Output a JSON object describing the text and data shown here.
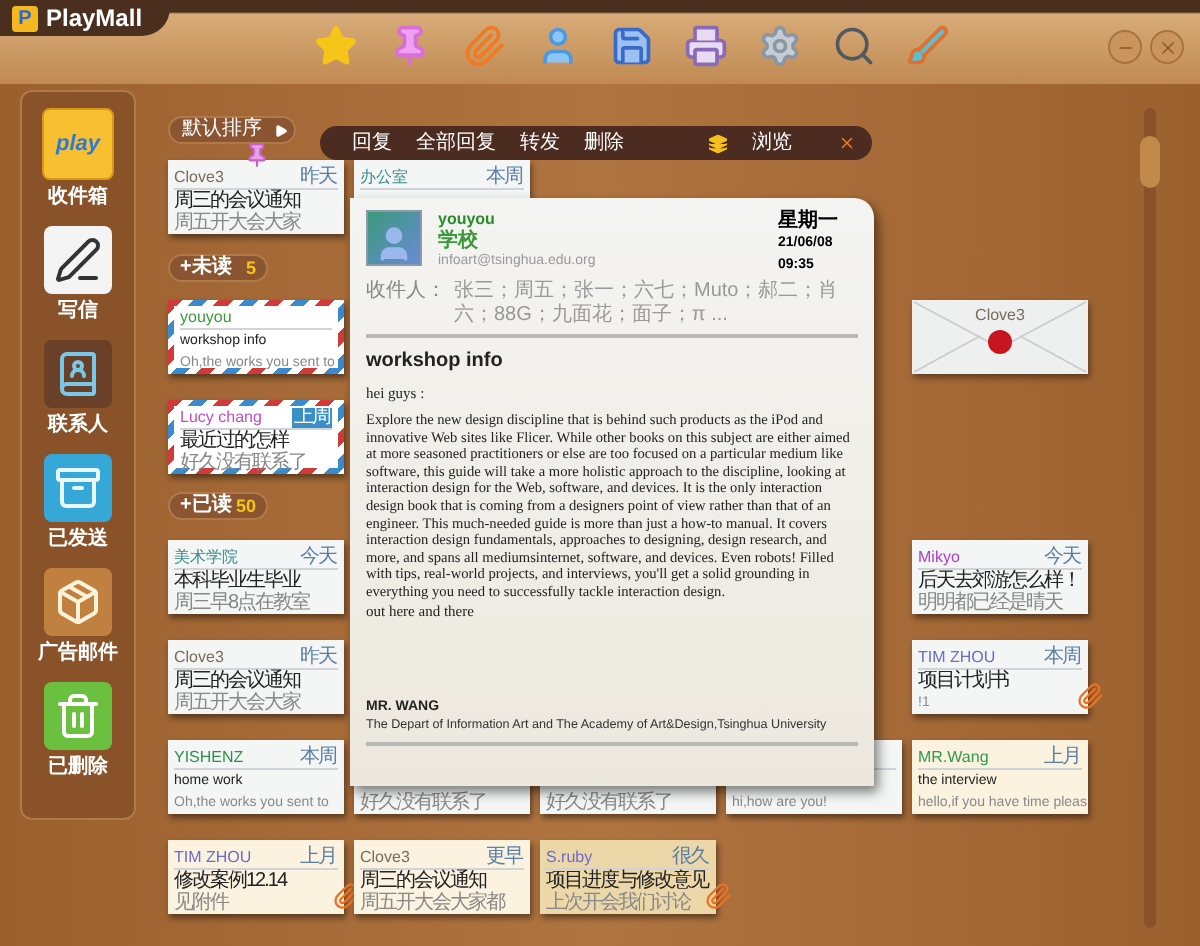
{
  "app": {
    "logo_mark": "P",
    "title": "PlayMall"
  },
  "sidebar": {
    "items": [
      {
        "label": "收件箱",
        "icon_text": "play"
      },
      {
        "label": "写信"
      },
      {
        "label": "联系人"
      },
      {
        "label": "已发送"
      },
      {
        "label": "广告邮件"
      },
      {
        "label": "已删除"
      }
    ]
  },
  "sort_button": {
    "label": "默认排序"
  },
  "top_row": [
    {
      "kind": "note",
      "sender": "Clove3",
      "color": "#7a6a58",
      "date": "昨天",
      "title": "周三的会议通知",
      "preview": "周五开大会大家",
      "flagged": false,
      "pinned": true,
      "clip": false
    },
    {
      "kind": "note",
      "sender": "办公室",
      "color": "#3a8a8a",
      "date": "本周",
      "flagged": false,
      "pinned": false,
      "clip": false
    },
    {
      "kind": "empty"
    },
    {
      "kind": "empty"
    },
    {
      "kind": "empty"
    }
  ],
  "sections": [
    {
      "label": "+未读",
      "count": "5",
      "rows": [
        [
          {
            "kind": "airmail",
            "sender": "youyou",
            "color": "#3a9a3a",
            "title": "workshop info",
            "preview": "Oh,the works you sent to",
            "flagged": false,
            "pinned": false,
            "clip": false
          },
          {
            "kind": "empty"
          },
          {
            "kind": "empty"
          },
          {
            "kind": "empty"
          },
          {
            "kind": "envelope",
            "sender": "Clove3",
            "color": "#7a6a58",
            "flagged": false,
            "pinned": false,
            "clip": false
          }
        ],
        [
          {
            "kind": "airmail",
            "sender": "Lucy chang",
            "color": "#c04fc0",
            "date": "上周",
            "title": "最近过的怎样",
            "preview": "好久没有联系了",
            "flagged": true,
            "pinned": false,
            "clip": false
          },
          {
            "kind": "empty"
          },
          {
            "kind": "empty"
          },
          {
            "kind": "empty"
          },
          {
            "kind": "empty"
          }
        ]
      ]
    },
    {
      "label": "+已读",
      "count": "50",
      "rows": [
        [
          {
            "kind": "note",
            "sender": "美术学院",
            "color": "#3a8a8a",
            "date": "今天",
            "title": "本科毕业生毕业",
            "preview": "周三早8点在教室",
            "flagged": false,
            "pinned": false,
            "clip": false
          },
          {
            "kind": "empty"
          },
          {
            "kind": "empty"
          },
          {
            "kind": "empty"
          },
          {
            "kind": "note",
            "sender": "Mikyo",
            "color": "#b03ad0",
            "date": "今天",
            "title": "后天去郊游怎么样！",
            "preview": "明明都已经是晴天",
            "flagged": false,
            "pinned": false,
            "clip": false
          }
        ],
        [
          {
            "kind": "note",
            "sender": "Clove3",
            "color": "#7a6a58",
            "date": "昨天",
            "title": "周三的会议通知",
            "preview": "周五开大会大家",
            "flagged": false,
            "pinned": false,
            "clip": false
          },
          {
            "kind": "empty"
          },
          {
            "kind": "empty"
          },
          {
            "kind": "empty"
          },
          {
            "kind": "note",
            "sender": "TIM ZHOU",
            "color": "#6a6ac8",
            "date": "本周",
            "title": "项目计划书",
            "preview": "!1",
            "flagged": false,
            "pinned": false,
            "clip": true
          }
        ],
        [
          {
            "kind": "note",
            "sender": "YISHENZ",
            "color": "#2f8f4a",
            "date": "本周",
            "title": "home work",
            "preview": "Oh,the works you sent to",
            "flagged": false,
            "pinned": false,
            "clip": false
          },
          {
            "kind": "note",
            "preview": "好久没有联系了",
            "flagged": false,
            "pinned": false,
            "clip": false
          },
          {
            "kind": "note",
            "preview": "好久没有联系了",
            "flagged": false,
            "pinned": false,
            "clip": false
          },
          {
            "kind": "note",
            "preview": "hi,how are you!",
            "flagged": false,
            "pinned": false,
            "clip": false
          },
          {
            "kind": "cream",
            "sender": "MR.Wang",
            "color": "#2f9a4a",
            "date": "上月",
            "title": "the interview",
            "preview": "hello,if you have time pleas",
            "flagged": false,
            "pinned": false,
            "clip": false
          }
        ],
        [
          {
            "kind": "cream",
            "sender": "TIM ZHOU",
            "color": "#6a6ac8",
            "date": "上月",
            "title": "修改案例12.14",
            "preview": "见附件",
            "flagged": false,
            "pinned": false,
            "clip": true
          },
          {
            "kind": "cream",
            "sender": "Clove3",
            "color": "#7a6a58",
            "date": "更早",
            "title": "周三的会议通知",
            "preview": "周五开大会大家都",
            "flagged": false,
            "pinned": false,
            "clip": false
          },
          {
            "kind": "tan",
            "sender": "S.ruby",
            "color": "#6a6ac8",
            "date": "很久",
            "title": "项目进度与修改意见",
            "preview": "上次开会我们讨论",
            "flagged": false,
            "pinned": false,
            "clip": true
          },
          {
            "kind": "empty"
          },
          {
            "kind": "empty"
          }
        ]
      ]
    }
  ],
  "reader": {
    "actions": [
      "回复",
      "全部回复",
      "转发",
      "删除"
    ],
    "view_label": "浏览",
    "sender": {
      "name": "youyou",
      "group": "学校",
      "email": "infoart@tsinghua.edu.org"
    },
    "weekday": "星期一",
    "date": "21/06/08",
    "time": "09:35",
    "recipients_label": "收件人：",
    "recipients": "张三；周五；张一；六七；Muto；郝二；肖六；88G；九面花；面子；π ...",
    "subject": "workshop info",
    "greeting": "hei guys :",
    "body": "Explore the new design discipline that is behind such products as the iPod and innovative Web sites like Flicer. While other books on this subject are either aimed at more seasoned practitioners or else are too focused on a particular medium like software, this guide will take a more holistic approach to the discipline, looking at interaction design for the Web, software, and devices. It is  the only interaction design book that is coming from a designers point of view rather than that of an engineer. This much-needed guide is more than just a how-to manual. It covers interaction design fundamentals, approaches to designing, design research, and more, and spans all mediumsinternet, software, and devices. Even robots! Filled with tips, real-world projects, and interviews, you'll get a solid grounding in everything you need to successfully tackle interaction design.",
    "closing": "out here and there",
    "signature_name": "MR. WANG",
    "signature_org": "The Depart of Information Art and The Academy of Art&Design,Tsinghua University"
  }
}
